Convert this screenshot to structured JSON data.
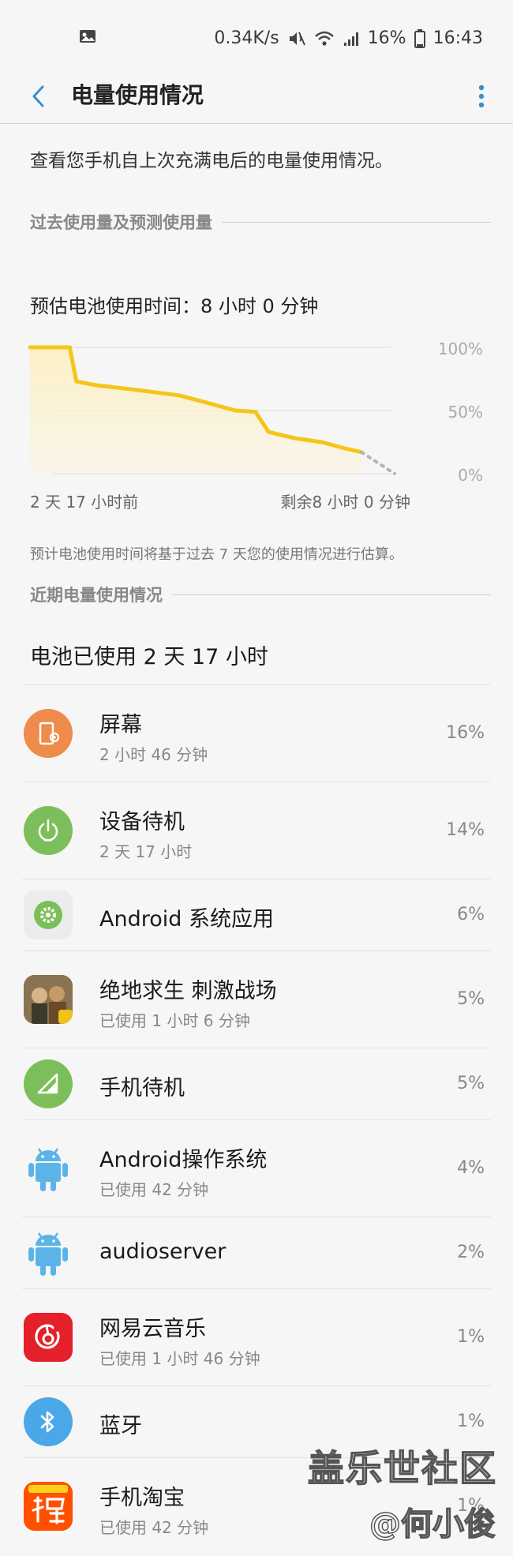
{
  "status_bar": {
    "speed": "0.34K/s",
    "battery": "16%",
    "time": "16:43",
    "icons": [
      "image-icon",
      "mute-icon",
      "wifi-icon",
      "signal-icon",
      "battery-icon"
    ]
  },
  "header": {
    "title": "电量使用情况",
    "back_icon": "chevron-left-icon",
    "more_icon": "more-vert-icon"
  },
  "description": "查看您手机自上次充满电后的电量使用情况。",
  "section_past": "过去使用量及预测使用量",
  "estimate": "预估电池使用时间：8 小时 0 分钟",
  "chart_data": {
    "type": "area",
    "y_ticks": [
      "100%",
      "50%",
      "0%"
    ],
    "ylim": [
      0,
      100
    ],
    "x_start_label": "2 天 17 小时前",
    "x_end_label": "剩余8 小时 0 分钟",
    "x": [
      0,
      0.12,
      0.14,
      0.2,
      0.3,
      0.45,
      0.55,
      0.62,
      0.68,
      0.72,
      0.8,
      0.88,
      0.95,
      1.0,
      1.1
    ],
    "values": [
      100,
      100,
      73,
      70,
      67,
      62,
      55,
      50,
      49,
      33,
      28,
      25,
      20,
      17,
      0
    ],
    "projected_from_index": 13,
    "line_color": "#f5c518",
    "fill_color": "#fdf0c8",
    "projection_color": "#b5b5b5",
    "grid": true
  },
  "footnote": "预计电池使用时间将基于过去 7 天您的使用情况进行估算。",
  "section_recent": "近期电量使用情况",
  "battery_used": "电池已使用 2 天 17 小时",
  "apps": [
    {
      "name": "屏幕",
      "sub": "2 小时 46 分钟",
      "pct": "16%",
      "icon": "screen-icon",
      "color": "#ef8b4b"
    },
    {
      "name": "设备待机",
      "sub": "2 天 17 小时",
      "pct": "14%",
      "icon": "power-icon",
      "color": "#7cbf5a"
    },
    {
      "name": "Android 系统应用",
      "sub": "",
      "pct": "6%",
      "icon": "gear-icon",
      "color": "#7cbf5a"
    },
    {
      "name": "绝地求生 刺激战场",
      "sub": "已使用 1 小时 6 分钟",
      "pct": "5%",
      "icon": "pubg-icon",
      "color": "#6b5a3a"
    },
    {
      "name": "手机待机",
      "sub": "",
      "pct": "5%",
      "icon": "signal-standby-icon",
      "color": "#7cbf5a"
    },
    {
      "name": "Android操作系统",
      "sub": "已使用 42 分钟",
      "pct": "4%",
      "icon": "android-icon",
      "color": "#5bb4e8"
    },
    {
      "name": "audioserver",
      "sub": "",
      "pct": "2%",
      "icon": "android-icon",
      "color": "#5bb4e8"
    },
    {
      "name": "网易云音乐",
      "sub": "已使用 1 小时 46 分钟",
      "pct": "1%",
      "icon": "netease-music-icon",
      "color": "#e4202a"
    },
    {
      "name": "蓝牙",
      "sub": "",
      "pct": "1%",
      "icon": "bluetooth-icon",
      "color": "#4aa8e8"
    },
    {
      "name": "手机淘宝",
      "sub": "已使用 42 分钟",
      "pct": "1%",
      "icon": "taobao-icon",
      "color": "#ff5000"
    }
  ],
  "watermark": {
    "line1": "盖乐世社区",
    "line2": "@何小俊"
  }
}
